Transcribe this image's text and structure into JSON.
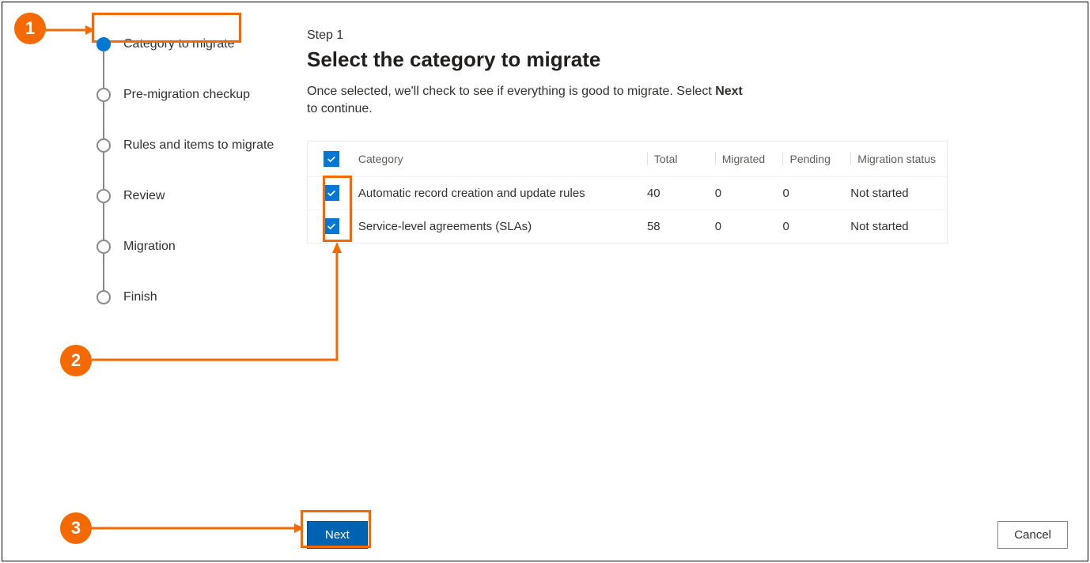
{
  "sidebar": {
    "steps": [
      {
        "label": "Category to migrate",
        "active": true
      },
      {
        "label": "Pre-migration checkup",
        "active": false
      },
      {
        "label": "Rules and items to migrate",
        "active": false
      },
      {
        "label": "Review",
        "active": false
      },
      {
        "label": "Migration",
        "active": false
      },
      {
        "label": "Finish",
        "active": false
      }
    ]
  },
  "main": {
    "step_label": "Step 1",
    "title": "Select the category to migrate",
    "desc_prefix": "Once selected, we'll check to see if everything is good to migrate. Select ",
    "desc_bold": "Next",
    "desc_suffix": " to continue."
  },
  "table": {
    "headers": {
      "category": "Category",
      "total": "Total",
      "migrated": "Migrated",
      "pending": "Pending",
      "status": "Migration status"
    },
    "rows": [
      {
        "category": "Automatic record creation and update rules",
        "total": "40",
        "migrated": "0",
        "pending": "0",
        "status": "Not started",
        "checked": true
      },
      {
        "category": "Service-level agreements (SLAs)",
        "total": "58",
        "migrated": "0",
        "pending": "0",
        "status": "Not started",
        "checked": true
      }
    ]
  },
  "buttons": {
    "next": "Next",
    "cancel": "Cancel"
  },
  "annotations": {
    "a1": "1",
    "a2": "2",
    "a3": "3"
  }
}
